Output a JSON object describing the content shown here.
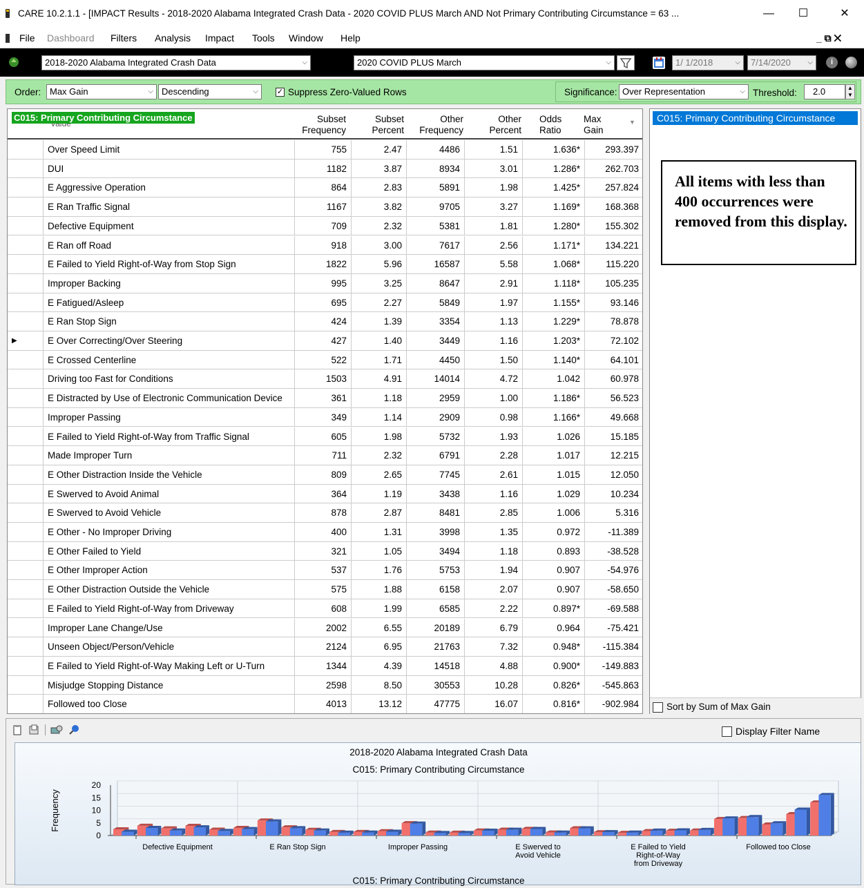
{
  "window": {
    "title": "CARE 10.2.1.1 - [IMPACT Results - 2018-2020 Alabama Integrated Crash Data - 2020 COVID PLUS March AND Not Primary Contributing Circumstance = 63 ...",
    "min": "—",
    "max": "☐",
    "close": "✕"
  },
  "menu": {
    "items": [
      "File",
      "Dashboard",
      "Filters",
      "Analysis",
      "Impact",
      "Tools",
      "Window",
      "Help"
    ],
    "mdi_controls": "_  ⧉  ✕"
  },
  "source": {
    "dataset": "2018-2020 Alabama Integrated Crash Data",
    "filter": "2020 COVID PLUS March",
    "date_from": "1/ 1/2018",
    "date_to": "7/14/2020"
  },
  "options": {
    "order_label": "Order:",
    "order_value": "Max Gain",
    "direction": "Descending",
    "suppress_label": "Suppress Zero-Valued Rows",
    "suppress_checked": "✓",
    "significance_label": "Significance:",
    "significance_value": "Over Representation",
    "threshold_label": "Threshold:",
    "threshold_value": "2.0"
  },
  "grid": {
    "title": "C015: Primary Contributing Circumstance",
    "value_header": "Value",
    "headers": [
      {
        "l1": "Subset",
        "l2": "Frequency"
      },
      {
        "l1": "Subset",
        "l2": "Percent"
      },
      {
        "l1": "Other",
        "l2": "Frequency"
      },
      {
        "l1": "Other",
        "l2": "Percent"
      },
      {
        "l1": "Odds",
        "l2": "Ratio"
      },
      {
        "l1": "Max",
        "l2": "Gain"
      }
    ],
    "rows": [
      {
        "name": "Over Speed Limit",
        "sf": "755",
        "sp": "2.47",
        "of": "4486",
        "op": "1.51",
        "or": "1.636*",
        "mg": "293.397"
      },
      {
        "name": "DUI",
        "sf": "1182",
        "sp": "3.87",
        "of": "8934",
        "op": "3.01",
        "or": "1.286*",
        "mg": "262.703"
      },
      {
        "name": "E Aggressive Operation",
        "sf": "864",
        "sp": "2.83",
        "of": "5891",
        "op": "1.98",
        "or": "1.425*",
        "mg": "257.824"
      },
      {
        "name": "E Ran Traffic Signal",
        "sf": "1167",
        "sp": "3.82",
        "of": "9705",
        "op": "3.27",
        "or": "1.169*",
        "mg": "168.368"
      },
      {
        "name": "Defective Equipment",
        "sf": "709",
        "sp": "2.32",
        "of": "5381",
        "op": "1.81",
        "or": "1.280*",
        "mg": "155.302"
      },
      {
        "name": "E Ran off Road",
        "sf": "918",
        "sp": "3.00",
        "of": "7617",
        "op": "2.56",
        "or": "1.171*",
        "mg": "134.221"
      },
      {
        "name": "E Failed to Yield Right-of-Way from Stop Sign",
        "sf": "1822",
        "sp": "5.96",
        "of": "16587",
        "op": "5.58",
        "or": "1.068*",
        "mg": "115.220"
      },
      {
        "name": "Improper Backing",
        "sf": "995",
        "sp": "3.25",
        "of": "8647",
        "op": "2.91",
        "or": "1.118*",
        "mg": "105.235"
      },
      {
        "name": "E Fatigued/Asleep",
        "sf": "695",
        "sp": "2.27",
        "of": "5849",
        "op": "1.97",
        "or": "1.155*",
        "mg": "93.146"
      },
      {
        "name": "E Ran Stop Sign",
        "sf": "424",
        "sp": "1.39",
        "of": "3354",
        "op": "1.13",
        "or": "1.229*",
        "mg": "78.878"
      },
      {
        "name": "E Over Correcting/Over Steering",
        "sf": "427",
        "sp": "1.40",
        "of": "3449",
        "op": "1.16",
        "or": "1.203*",
        "mg": "72.102",
        "current": "▶"
      },
      {
        "name": "E Crossed Centerline",
        "sf": "522",
        "sp": "1.71",
        "of": "4450",
        "op": "1.50",
        "or": "1.140*",
        "mg": "64.101"
      },
      {
        "name": "Driving too Fast for Conditions",
        "sf": "1503",
        "sp": "4.91",
        "of": "14014",
        "op": "4.72",
        "or": "1.042",
        "mg": "60.978"
      },
      {
        "name": "E Distracted by Use of Electronic Communication Device",
        "sf": "361",
        "sp": "1.18",
        "of": "2959",
        "op": "1.00",
        "or": "1.186*",
        "mg": "56.523"
      },
      {
        "name": "Improper Passing",
        "sf": "349",
        "sp": "1.14",
        "of": "2909",
        "op": "0.98",
        "or": "1.166*",
        "mg": "49.668"
      },
      {
        "name": "E Failed to Yield Right-of-Way from Traffic Signal",
        "sf": "605",
        "sp": "1.98",
        "of": "5732",
        "op": "1.93",
        "or": "1.026",
        "mg": "15.185"
      },
      {
        "name": "Made Improper Turn",
        "sf": "711",
        "sp": "2.32",
        "of": "6791",
        "op": "2.28",
        "or": "1.017",
        "mg": "12.215"
      },
      {
        "name": "E Other Distraction Inside the Vehicle",
        "sf": "809",
        "sp": "2.65",
        "of": "7745",
        "op": "2.61",
        "or": "1.015",
        "mg": "12.050"
      },
      {
        "name": "E Swerved to Avoid Animal",
        "sf": "364",
        "sp": "1.19",
        "of": "3438",
        "op": "1.16",
        "or": "1.029",
        "mg": "10.234"
      },
      {
        "name": "E Swerved to Avoid Vehicle",
        "sf": "878",
        "sp": "2.87",
        "of": "8481",
        "op": "2.85",
        "or": "1.006",
        "mg": "5.316"
      },
      {
        "name": "E Other - No Improper Driving",
        "sf": "400",
        "sp": "1.31",
        "of": "3998",
        "op": "1.35",
        "or": "0.972",
        "mg": "-11.389"
      },
      {
        "name": "E Other Failed to Yield",
        "sf": "321",
        "sp": "1.05",
        "of": "3494",
        "op": "1.18",
        "or": "0.893",
        "mg": "-38.528"
      },
      {
        "name": "E Other Improper Action",
        "sf": "537",
        "sp": "1.76",
        "of": "5753",
        "op": "1.94",
        "or": "0.907",
        "mg": "-54.976"
      },
      {
        "name": "E Other Distraction Outside the Vehicle",
        "sf": "575",
        "sp": "1.88",
        "of": "6158",
        "op": "2.07",
        "or": "0.907",
        "mg": "-58.650"
      },
      {
        "name": "E Failed to Yield Right-of-Way from Driveway",
        "sf": "608",
        "sp": "1.99",
        "of": "6585",
        "op": "2.22",
        "or": "0.897*",
        "mg": "-69.588"
      },
      {
        "name": "Improper Lane Change/Use",
        "sf": "2002",
        "sp": "6.55",
        "of": "20189",
        "op": "6.79",
        "or": "0.964",
        "mg": "-75.421"
      },
      {
        "name": "Unseen Object/Person/Vehicle",
        "sf": "2124",
        "sp": "6.95",
        "of": "21763",
        "op": "7.32",
        "or": "0.948*",
        "mg": "-115.384"
      },
      {
        "name": "E Failed to Yield Right-of-Way Making Left or U-Turn",
        "sf": "1344",
        "sp": "4.39",
        "of": "14518",
        "op": "4.88",
        "or": "0.900*",
        "mg": "-149.883"
      },
      {
        "name": "Misjudge Stopping Distance",
        "sf": "2598",
        "sp": "8.50",
        "of": "30553",
        "op": "10.28",
        "or": "0.826*",
        "mg": "-545.863"
      },
      {
        "name": "Followed too Close",
        "sf": "4013",
        "sp": "13.12",
        "of": "47775",
        "op": "16.07",
        "or": "0.816*",
        "mg": "-902.984"
      }
    ]
  },
  "right_panel": {
    "header": "C015: Primary Contributing Circumstance",
    "note": "All items with less than 400 occurrences were removed from this display.",
    "sort_label": "Sort by Sum of Max Gain"
  },
  "chart_panel": {
    "display_filter_label": "Display Filter Name"
  },
  "colors": {
    "subset": "#f2706c",
    "other": "#4f7fe6",
    "accent": "#0078d7",
    "green": "#a6e6a4"
  },
  "chart_data": {
    "type": "bar",
    "title": "2018-2020 Alabama Integrated Crash Data",
    "subtitle": "C015: Primary Contributing Circumstance",
    "xlabel": "C015: Primary Contributing Circumstance",
    "ylabel": "Frequency",
    "ylim": [
      0,
      20
    ],
    "yticks": [
      "20",
      "15",
      "10",
      "5",
      "0"
    ],
    "xtick_labels": [
      "Defective Equipment",
      "E Ran Stop Sign",
      "Improper Passing",
      "E Swerved to\nAvoid Vehicle",
      "E Failed to Yield\nRight-of-Way\nfrom Driveway",
      "Followed too Close"
    ],
    "series": [
      {
        "values": [
          2.47,
          3.87,
          2.83,
          3.82,
          2.32,
          3.0,
          5.96,
          3.25,
          2.27,
          1.39,
          1.4,
          1.71,
          4.91,
          1.18,
          1.14,
          1.98,
          2.32,
          2.65,
          1.19,
          2.87,
          1.31,
          1.05,
          1.76,
          1.88,
          1.99,
          6.55,
          6.95,
          4.39,
          8.5,
          13.12
        ]
      },
      {
        "values": [
          1.51,
          3.01,
          1.98,
          3.27,
          1.81,
          2.56,
          5.58,
          2.91,
          1.97,
          1.13,
          1.16,
          1.5,
          4.72,
          1.0,
          0.98,
          1.93,
          2.28,
          2.61,
          1.16,
          2.85,
          1.35,
          1.18,
          1.94,
          2.07,
          2.22,
          6.79,
          7.32,
          4.88,
          10.28,
          16.07
        ]
      }
    ]
  }
}
